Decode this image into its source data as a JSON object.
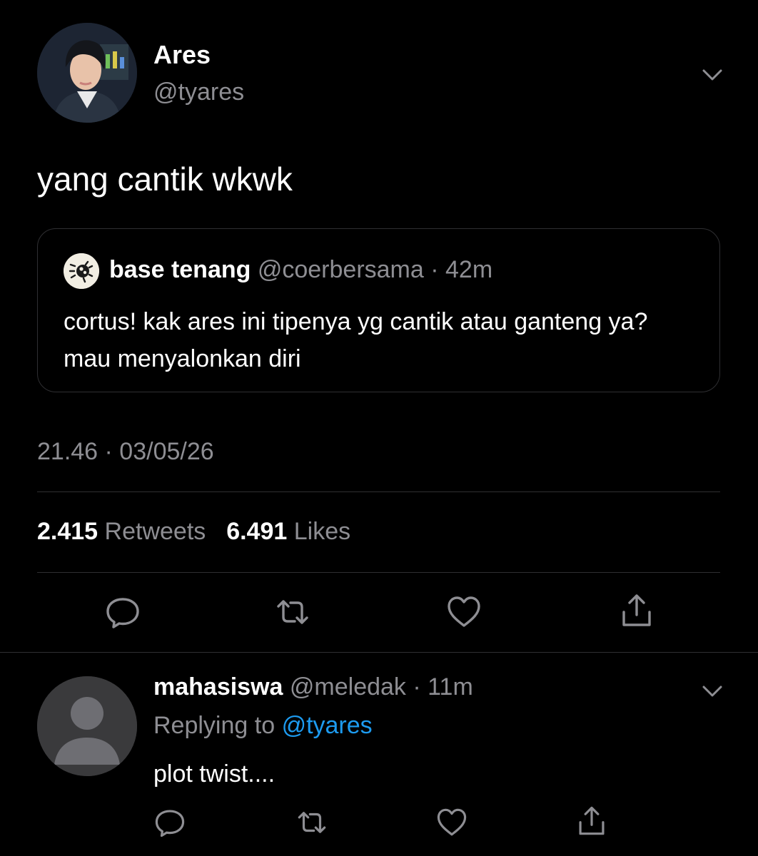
{
  "tweet": {
    "author_name": "Ares",
    "author_handle": "@tyares",
    "text": "yang cantik wkwk",
    "timestamp": "21.46 · 03/05/26",
    "quote": {
      "name": "base tenang",
      "handle": "@coerbersama",
      "time": "42m",
      "text": "cortus! kak ares ini tipenya yg cantik atau ganteng ya? mau menyalonkan diri"
    },
    "stats": {
      "retweets_count": "2.415",
      "retweets_label": "Retweets",
      "likes_count": "6.491",
      "likes_label": "Likes"
    }
  },
  "reply": {
    "name": "mahasiswa",
    "handle": "@meledak",
    "time": "11m",
    "replying_prefix": "Replying to",
    "replying_handle": "@tyares",
    "text": "plot twist...."
  },
  "icons": {
    "menu": "chevron-down-icon",
    "reply": "reply-bubble-icon",
    "retweet": "retweet-icon",
    "like": "heart-icon",
    "share": "share-icon"
  },
  "colors": {
    "background": "#000000",
    "text": "#ffffff",
    "secondary": "#8e8e93",
    "link": "#1d9bf0",
    "divider": "#2f2f32"
  }
}
